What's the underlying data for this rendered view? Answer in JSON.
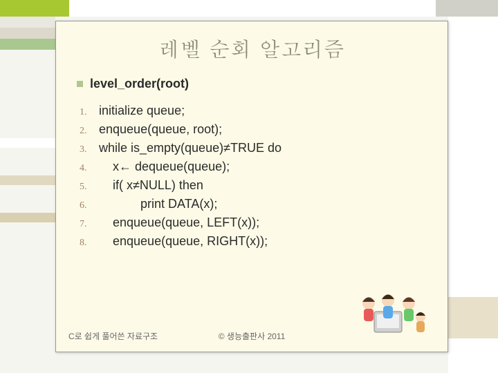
{
  "title": "레벨 순회 알고리즘",
  "heading": "level_order(root)",
  "steps": [
    {
      "n": "1.",
      "text": "initialize queue;"
    },
    {
      "n": "2.",
      "text": "enqueue(queue, root);"
    },
    {
      "n": "3.",
      "text": "while is_empty(queue)≠TRUE do"
    },
    {
      "n": "4.",
      "text": "    x← dequeue(queue);"
    },
    {
      "n": "5.",
      "text": "    if( x≠NULL) then"
    },
    {
      "n": "6.",
      "text": "            print DATA(x);"
    },
    {
      "n": "7.",
      "text": "    enqueue(queue, LEFT(x));"
    },
    {
      "n": "8.",
      "text": "    enqueue(queue, RIGHT(x));"
    }
  ],
  "footer_left": "C로 쉽게 풀어쓴 자료구조",
  "footer_center": "© 생능출판사 2011"
}
